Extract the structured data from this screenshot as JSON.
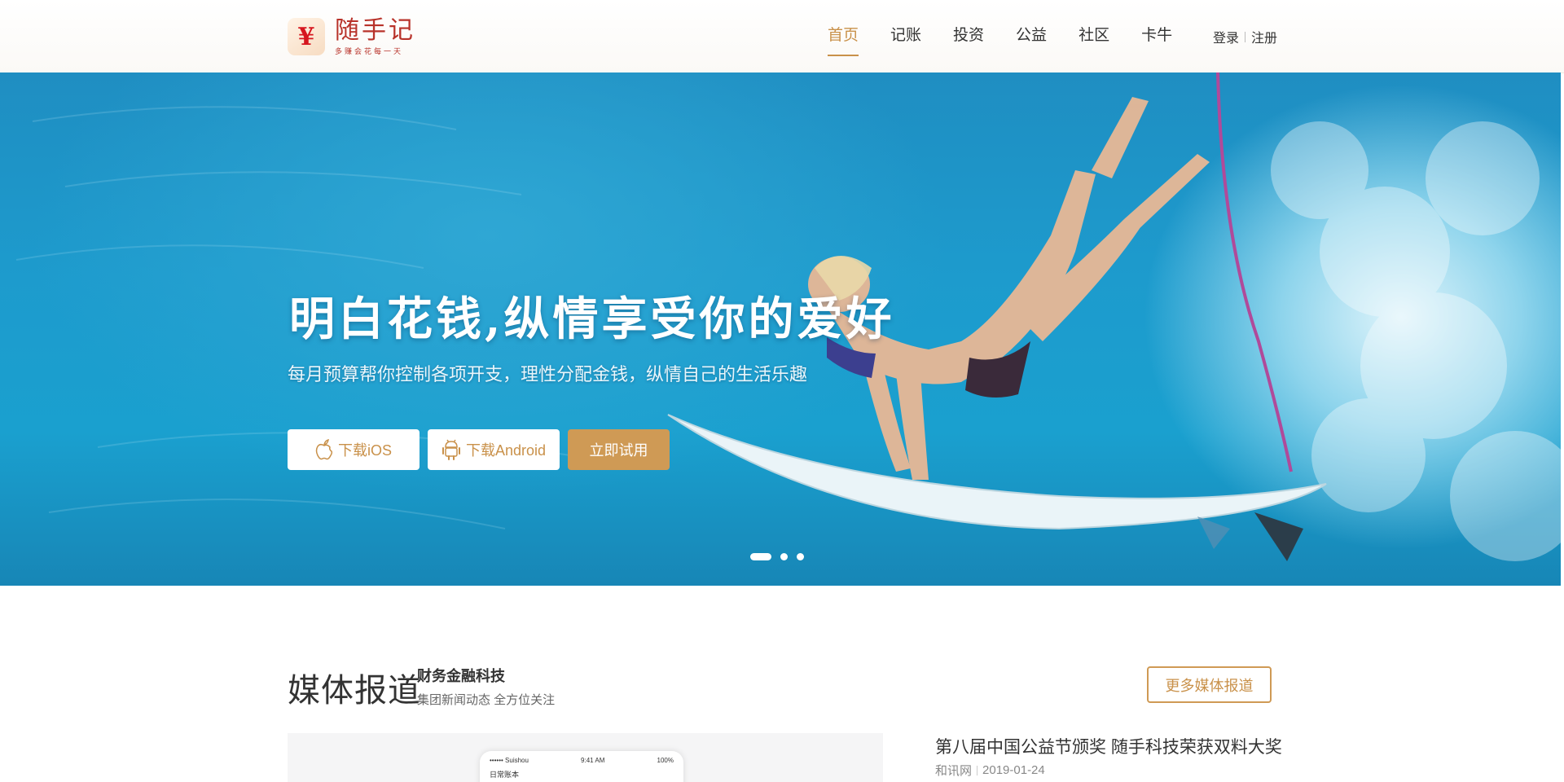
{
  "brand": {
    "logo_symbol": "¥",
    "name": "随手记",
    "slogan": "多赚会花每一天"
  },
  "nav": {
    "items": [
      {
        "label": "首页",
        "active": true
      },
      {
        "label": "记账",
        "active": false
      },
      {
        "label": "投资",
        "active": false
      },
      {
        "label": "公益",
        "active": false
      },
      {
        "label": "社区",
        "active": false
      },
      {
        "label": "卡牛",
        "active": false
      }
    ],
    "login": "登录",
    "register": "注册"
  },
  "hero": {
    "title": "明白花钱,纵情享受你的爱好",
    "subtitle": "每月预算帮你控制各项开支，理性分配金钱，纵情自己的生活乐趣",
    "buttons": {
      "ios": "下载iOS",
      "android": "下载Android",
      "try": "立即试用"
    },
    "slides": {
      "count": 3,
      "active_index": 0
    }
  },
  "media": {
    "title": "媒体报道",
    "subtitle": "财务金融科技",
    "tagline": "集团新闻动态 全方位关注",
    "more_button": "更多媒体报道",
    "phone": {
      "carrier": "•••••• Suishou",
      "time": "9:41 AM",
      "battery": "100%",
      "book": "日常账本"
    },
    "news": [
      {
        "title": "第八届中国公益节颁奖 随手科技荣获双料大奖",
        "source": "和讯网",
        "date": "2019-01-24"
      }
    ]
  },
  "colors": {
    "accent": "#cf9a55",
    "nav_active": "#c9914a",
    "logo_red": "#d6161f"
  }
}
